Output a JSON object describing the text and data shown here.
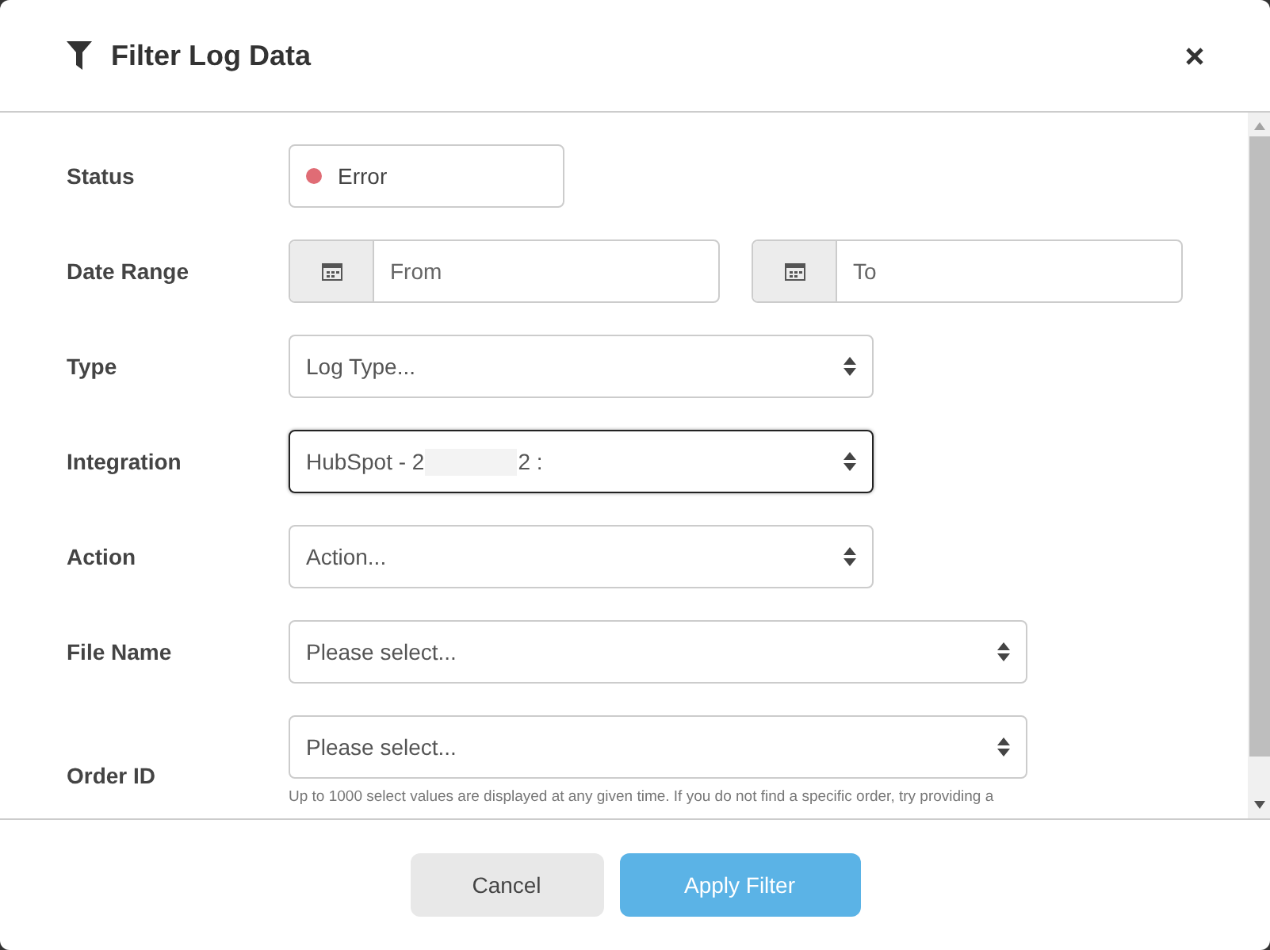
{
  "dialog": {
    "title": "Filter Log Data"
  },
  "fields": [
    {
      "kind": "status",
      "label": "Status",
      "value": "Error",
      "color": "#e06c75"
    },
    {
      "kind": "daterange",
      "label": "Date Range",
      "from_placeholder": "From",
      "to_placeholder": "To"
    },
    {
      "kind": "select",
      "label": "Type",
      "placeholder": "Log Type...",
      "focused": false,
      "wide": false
    },
    {
      "kind": "select",
      "label": "Integration",
      "value": "HubSpot - 2",
      "redacted": true,
      "value_suffix": "2 :",
      "focused": true,
      "wide": false
    },
    {
      "kind": "select",
      "label": "Action",
      "placeholder": "Action...",
      "focused": false,
      "wide": false
    },
    {
      "kind": "select",
      "label": "File Name",
      "placeholder": "Please select...",
      "focused": false,
      "wide": true
    },
    {
      "kind": "select",
      "label": "Order ID",
      "placeholder": "Please select...",
      "focused": false,
      "wide": true,
      "help": "Up to 1000 select values are displayed at any given time. If you do not find a specific order, try providing a"
    }
  ],
  "buttons": [
    {
      "label": "Cancel",
      "kind": "secondary"
    },
    {
      "label": "Apply Filter",
      "kind": "primary"
    }
  ]
}
